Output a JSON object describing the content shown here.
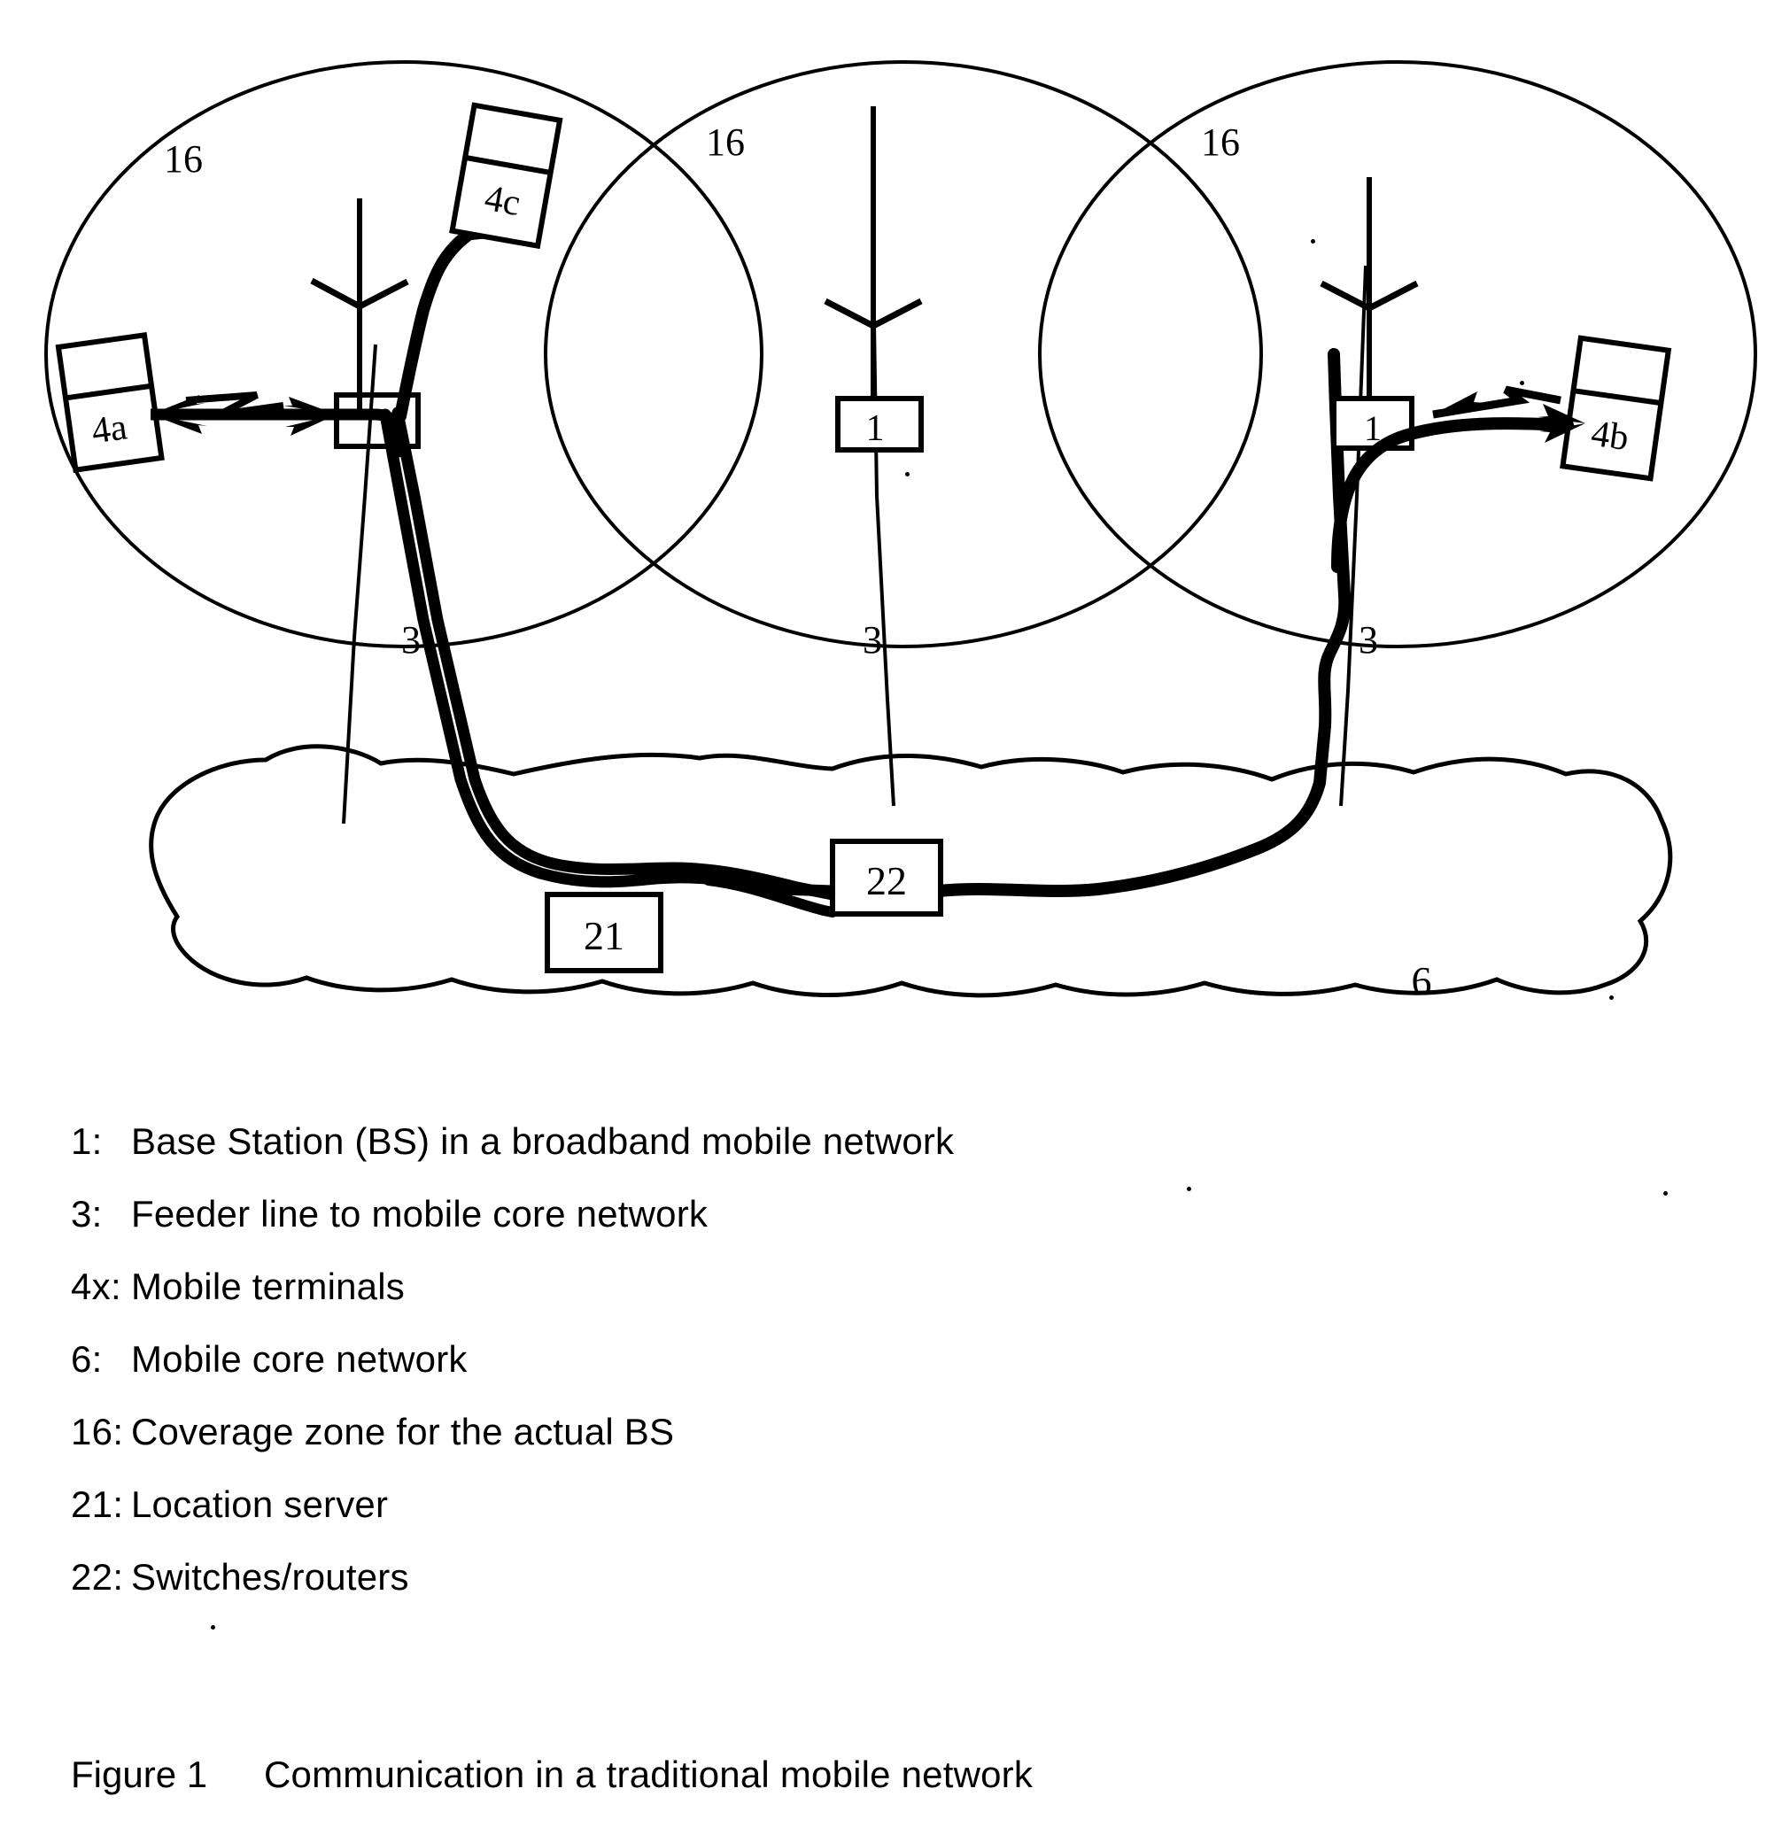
{
  "figure": {
    "caption_label": "Figure 1",
    "caption_text": "Communication in a traditional mobile network"
  },
  "legend": {
    "items": [
      {
        "key": "1:",
        "desc": "Base Station (BS) in a broadband mobile network"
      },
      {
        "key": "3:",
        "desc": "Feeder line to mobile core network"
      },
      {
        "key": "4x:",
        "desc": "Mobile terminals"
      },
      {
        "key": "6:",
        "desc": "Mobile core network"
      },
      {
        "key": "16:",
        "desc": "Coverage zone for the actual BS"
      },
      {
        "key": "21:",
        "desc": "Location server"
      },
      {
        "key": "22:",
        "desc": "Switches/routers"
      }
    ]
  },
  "diagram": {
    "coverage_zones": [
      {
        "id": "zone-left",
        "label": "16"
      },
      {
        "id": "zone-center",
        "label": "16"
      },
      {
        "id": "zone-right",
        "label": "16"
      }
    ],
    "base_stations": [
      {
        "id": "bs-left",
        "label": ""
      },
      {
        "id": "bs-center",
        "label": "1"
      },
      {
        "id": "bs-right",
        "label": "1"
      }
    ],
    "terminals": [
      {
        "id": "terminal-4a",
        "label": "4a"
      },
      {
        "id": "terminal-4b",
        "label": "4b"
      },
      {
        "id": "terminal-4c",
        "label": "4c"
      }
    ],
    "feeder_lines": [
      {
        "id": "feeder-left",
        "label": "3"
      },
      {
        "id": "feeder-center",
        "label": "3"
      },
      {
        "id": "feeder-right",
        "label": "3"
      }
    ],
    "core_network": {
      "label": "6",
      "nodes": [
        {
          "id": "location-server",
          "label": "21"
        },
        {
          "id": "switch-router",
          "label": "22"
        }
      ]
    },
    "colors": {
      "ink": "#000000",
      "paper": "#ffffff"
    }
  }
}
